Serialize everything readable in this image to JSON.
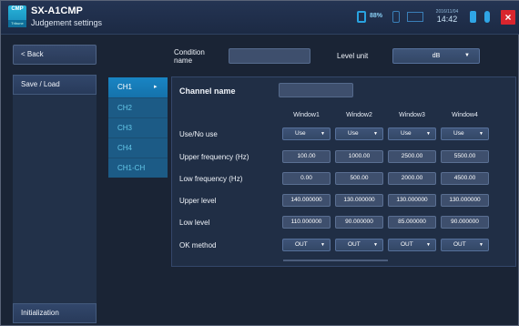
{
  "header": {
    "logo_text": "CMP",
    "logo_sub": "Tribune",
    "title": "SX-A1CMP",
    "subtitle": "Judgement settings",
    "battery_pct": "88%",
    "date": "2016/11/04",
    "time": "14:42",
    "close_label": "×"
  },
  "sidebar": {
    "back_label": "< Back",
    "save_load_label": "Save / Load",
    "initialization_label": "Initialization"
  },
  "channels": {
    "items": [
      "CH1",
      "CH2",
      "CH3",
      "CH4",
      "CH1-CH"
    ],
    "active_index": 0,
    "active_arrow": "▸"
  },
  "condition": {
    "name_label": "Condition name",
    "name_value": "",
    "level_unit_label": "Level unit",
    "level_unit_value": "dB"
  },
  "table": {
    "channel_name_label": "Channel name",
    "channel_name_value": "",
    "columns": [
      "Window1",
      "Window2",
      "Window3",
      "Window4"
    ],
    "rows": [
      {
        "label": "Use/No use",
        "type": "select",
        "values": [
          "Use",
          "Use",
          "Use",
          "Use"
        ]
      },
      {
        "label": "Upper frequency (Hz)",
        "type": "value",
        "values": [
          "100.00",
          "1000.00",
          "2500.00",
          "5500.00"
        ]
      },
      {
        "label": "Low frequency (Hz)",
        "type": "value",
        "values": [
          "0.00",
          "500.00",
          "2000.00",
          "4500.00"
        ]
      },
      {
        "label": "Upper level",
        "type": "value",
        "values": [
          "140.000000",
          "130.000000",
          "130.000000",
          "130.000000"
        ]
      },
      {
        "label": "Low level",
        "type": "value",
        "values": [
          "110.000000",
          "90.000000",
          "85.000000",
          "90.000000"
        ]
      },
      {
        "label": "OK method",
        "type": "select",
        "values": [
          "OUT",
          "OUT",
          "OUT",
          "OUT"
        ]
      }
    ]
  },
  "icons": {
    "battery": "battery-icon",
    "sd": "sd-card-icon",
    "wave": "waveform-icon",
    "usb": "usb-icon",
    "mic": "microphone-icon",
    "close": "close-icon",
    "dropdown": "chevron-down-icon"
  },
  "colors": {
    "background": "#1a2435",
    "active_channel": "#1985c4",
    "inactive_channel": "#1c5b86",
    "close_button": "#d9252e",
    "accent": "#29a3e0"
  }
}
